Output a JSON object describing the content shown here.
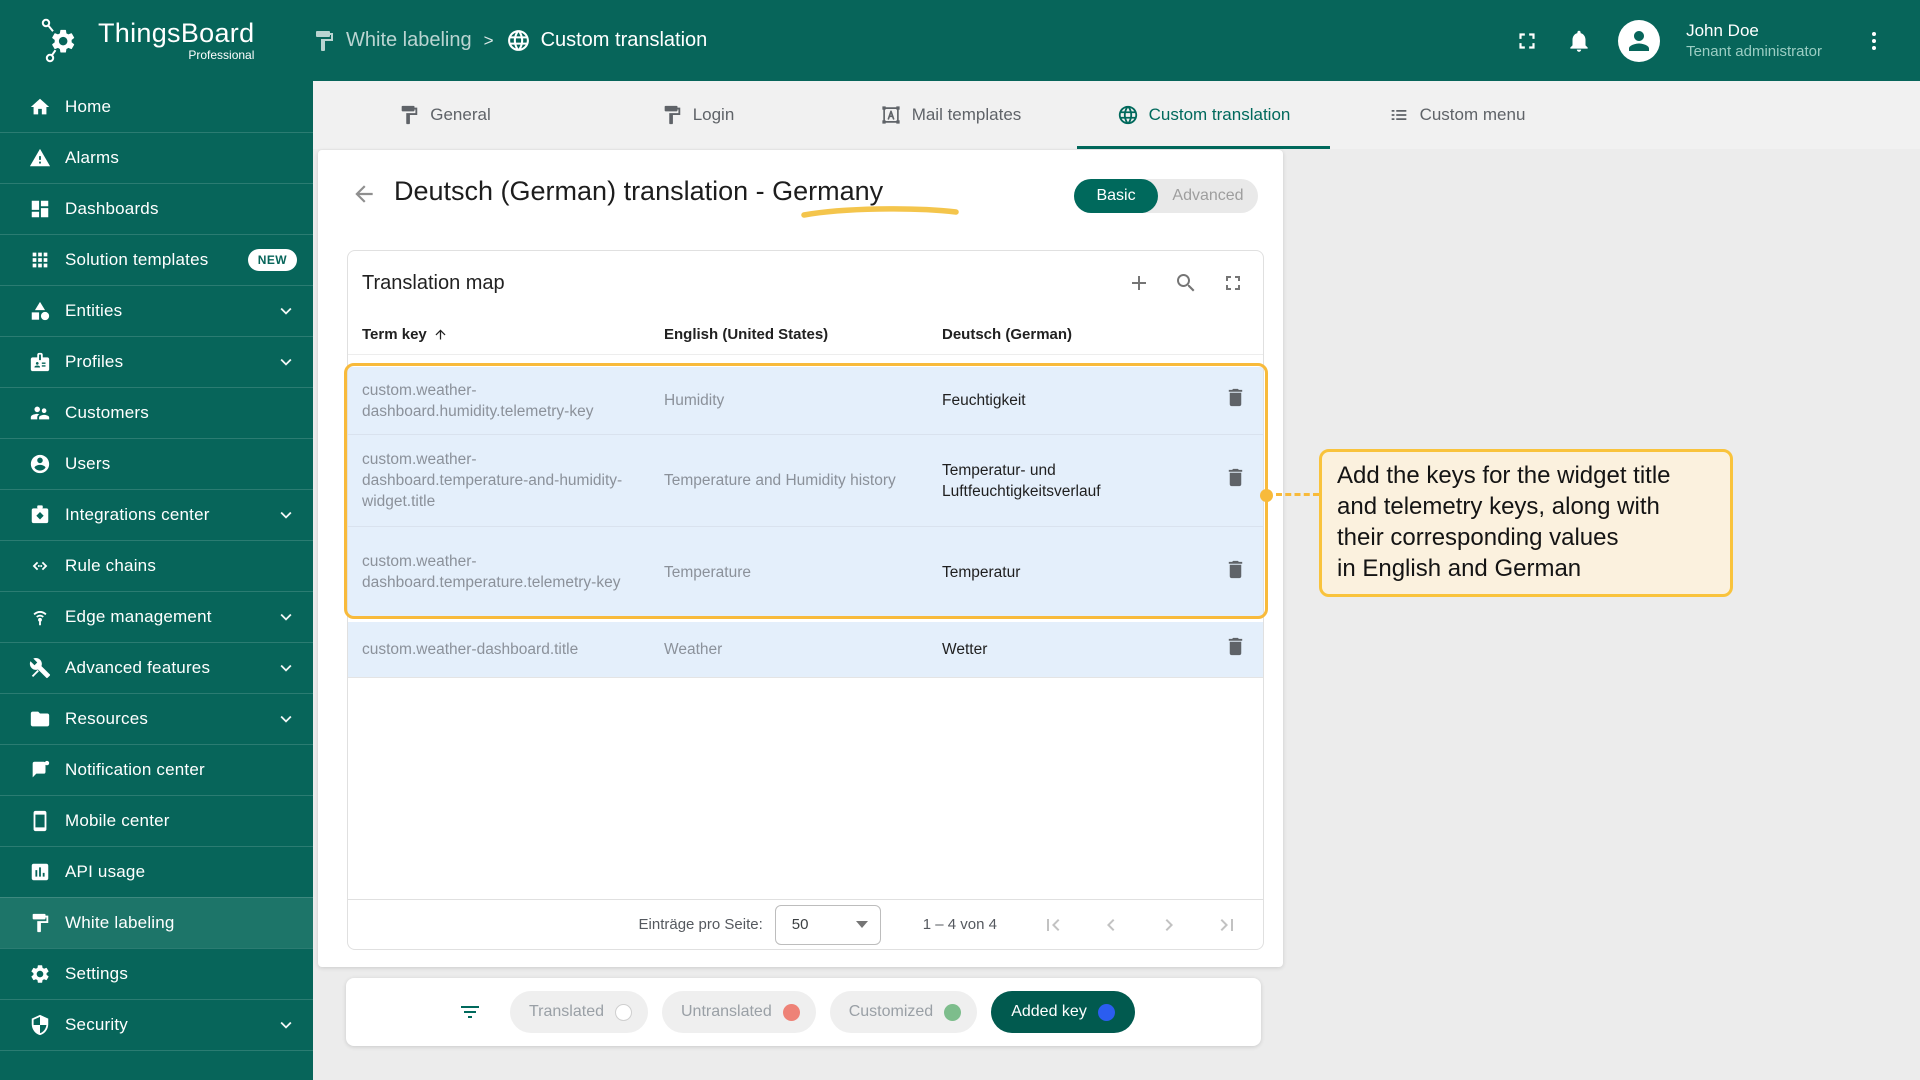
{
  "colors": {
    "primary_teal": "#07655a",
    "active_item_teal": "#1d7569",
    "accent_teal": "#00695c",
    "row_highlight_blue": "#e4effb",
    "annotation_orange": "#f8ba3b",
    "callout_background": "#fbf1de",
    "chip_untranslated_dot": "#ee8277",
    "chip_customized_dot": "#7dbd8c",
    "chip_added_dot": "#2b5df0"
  },
  "header": {
    "product": "ThingsBoard",
    "edition": "Professional",
    "breadcrumb": {
      "section": "White labeling",
      "separator": ">",
      "page": "Custom translation"
    },
    "user": {
      "name": "John Doe",
      "role": "Tenant administrator"
    }
  },
  "sidebar": {
    "items": [
      {
        "label": "Home"
      },
      {
        "label": "Alarms"
      },
      {
        "label": "Dashboards"
      },
      {
        "label": "Solution templates",
        "badge": "NEW"
      },
      {
        "label": "Entities"
      },
      {
        "label": "Profiles"
      },
      {
        "label": "Customers"
      },
      {
        "label": "Users"
      },
      {
        "label": "Integrations center"
      },
      {
        "label": "Rule chains"
      },
      {
        "label": "Edge management"
      },
      {
        "label": "Advanced features"
      },
      {
        "label": "Resources"
      },
      {
        "label": "Notification center"
      },
      {
        "label": "Mobile center"
      },
      {
        "label": "API usage"
      },
      {
        "label": "White labeling",
        "active": true
      },
      {
        "label": "Settings"
      },
      {
        "label": "Security"
      }
    ]
  },
  "tabs": [
    {
      "label": "General"
    },
    {
      "label": "Login"
    },
    {
      "label": "Mail templates"
    },
    {
      "label": "Custom translation",
      "active": true
    },
    {
      "label": "Custom menu"
    }
  ],
  "page": {
    "title": "Deutsch (German) translation - Germany",
    "mode_toggle": {
      "basic": "Basic",
      "advanced": "Advanced",
      "selected": "Basic"
    },
    "table": {
      "title": "Translation map",
      "columns": {
        "term": "Term key",
        "english": "English (United States)",
        "german": "Deutsch (German)"
      },
      "rows": [
        {
          "key": "custom.weather-dashboard.humidity.telemetry-key",
          "en": "Humidity",
          "de": "Feuchtigkeit"
        },
        {
          "key": "custom.weather-dashboard.temperature-and-humidity-widget.title",
          "en": "Temperature and Humidity history",
          "de": "Temperatur- und Luftfeuchtigkeitsverlauf"
        },
        {
          "key": "custom.weather-dashboard.temperature.telemetry-key",
          "en": "Temperature",
          "de": "Temperatur"
        },
        {
          "key": "custom.weather-dashboard.title",
          "en": "Weather",
          "de": "Wetter"
        }
      ]
    },
    "pagination": {
      "items_per_page_label": "Einträge pro Seite:",
      "page_size": "50",
      "range": "1 – 4 von 4"
    },
    "legend": {
      "chips": [
        {
          "label": "Translated"
        },
        {
          "label": "Untranslated"
        },
        {
          "label": "Customized"
        },
        {
          "label": "Added key",
          "active": true
        }
      ]
    }
  },
  "annotation": {
    "note": "Add the keys for the widget title\nand telemetry keys, along with\ntheir corresponding values\nin English and German"
  }
}
